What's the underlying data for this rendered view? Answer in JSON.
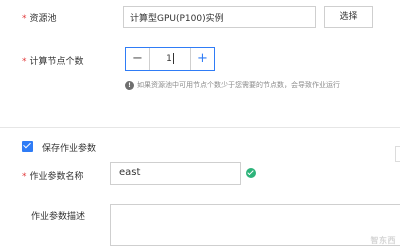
{
  "resource_pool": {
    "required_mark": "*",
    "label": "资源池",
    "value": "计算型GPU(P100)实例",
    "select_button": "选择"
  },
  "compute_nodes": {
    "required_mark": "*",
    "label": "计算节点个数",
    "minus": "−",
    "value": "1",
    "plus": "+",
    "hint": "如果资源池中可用节点个数少于您需要的节点数，会导致作业运行"
  },
  "save_params": {
    "checked": true,
    "label": "保存作业参数"
  },
  "param_name": {
    "required_mark": "*",
    "label": "作业参数名称",
    "value": "east"
  },
  "param_desc": {
    "label": "作业参数描述",
    "value": ""
  },
  "watermark": "智东西",
  "colors": {
    "accent": "#2f7cf6",
    "required": "#e2393a",
    "success": "#2db37a"
  }
}
